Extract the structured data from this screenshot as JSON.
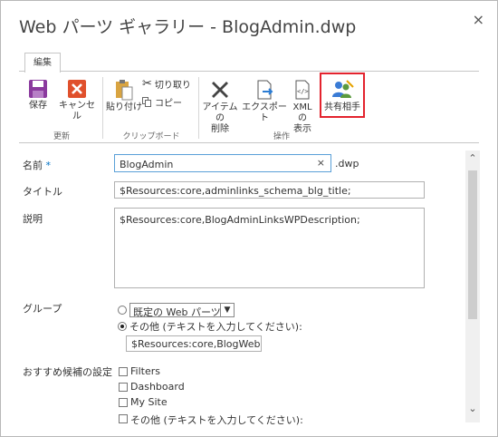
{
  "dialog": {
    "title": "Web パーツ ギャラリー - BlogAdmin.dwp",
    "close_glyph": "×"
  },
  "ribbon": {
    "tab_label": "編集",
    "buttons": {
      "save": "保存",
      "cancel": "キャンセル",
      "paste": "貼り付け",
      "cut": "切り取り",
      "copy": "コピー",
      "delete_line1": "アイテムの",
      "delete_line2": "削除",
      "export": "エクスポート",
      "xml_line1": "XML の",
      "xml_line2": "表示",
      "share": "共有相手"
    },
    "groups": {
      "commit": "更新",
      "clipboard": "クリップボード",
      "actions": "操作"
    },
    "colors": {
      "save": "#8b3a9e",
      "cancel": "#e0502c",
      "highlight": "#e3232e"
    }
  },
  "form": {
    "name_label": "名前",
    "required_mark": "*",
    "name_value": "BlogAdmin",
    "name_suffix": ".dwp",
    "title_label": "タイトル",
    "title_value": "$Resources:core,adminlinks_schema_blg_title;",
    "desc_label": "説明",
    "desc_value": "$Resources:core,BlogAdminLinksWPDescription;",
    "group_label": "グループ",
    "group_option_default": "",
    "group_default_select": "既定の Web パーツ",
    "group_option_other": "その他 (テキストを入力してください):",
    "group_other_value": "$Resources:core,BlogWeb",
    "recommend_label": "おすすめ候補の設定",
    "recommend_options": [
      "Filters",
      "Dashboard",
      "My Site",
      "その他 (テキストを入力してください):"
    ],
    "clear_glyph": "×"
  }
}
